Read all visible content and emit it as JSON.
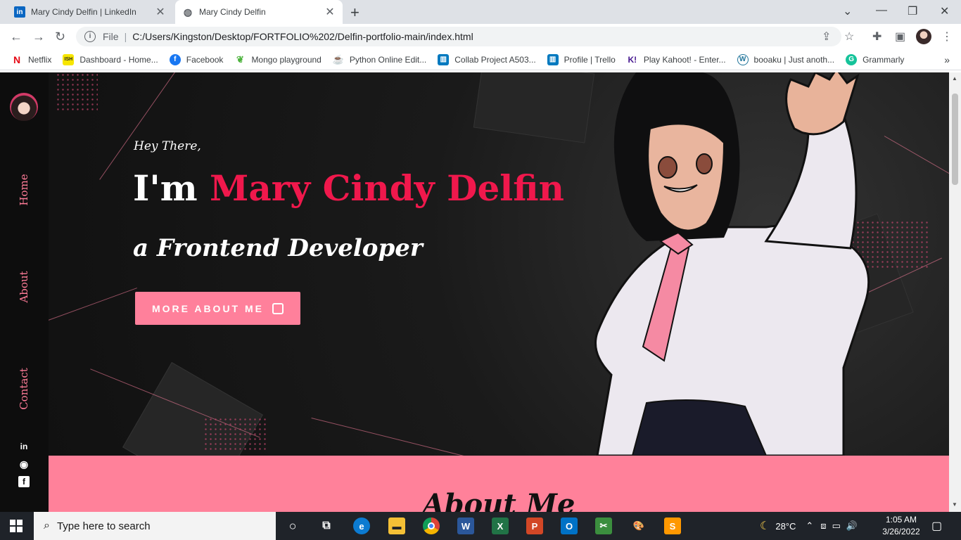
{
  "browser": {
    "tabs": [
      {
        "title": "Mary Cindy Delfin | LinkedIn",
        "icon": "linkedin-icon"
      },
      {
        "title": "Mary Cindy Delfin",
        "icon": "globe-icon"
      }
    ],
    "address": {
      "scheme_label": "File",
      "url": "C:/Users/Kingston/Desktop/FORTFOLIO%202/Delfin-portfolio-main/index.html"
    },
    "bookmarks": [
      {
        "label": "Netflix",
        "icon": "netflix-icon",
        "color": "#e50914"
      },
      {
        "label": "Dashboard - Home...",
        "icon": "dashboard-icon",
        "color": "#f7e600"
      },
      {
        "label": "Facebook",
        "icon": "facebook-icon",
        "color": "#1877f2"
      },
      {
        "label": "Mongo playground",
        "icon": "mongo-icon",
        "color": "#4db33d"
      },
      {
        "label": "Python Online Edit...",
        "icon": "python-icon",
        "color": "#333333"
      },
      {
        "label": "Collab Project A503...",
        "icon": "trello-icon",
        "color": "#0079bf"
      },
      {
        "label": "Profile | Trello",
        "icon": "trello-icon",
        "color": "#0079bf"
      },
      {
        "label": "Play Kahoot! - Enter...",
        "icon": "kahoot-icon",
        "color": "#46178f"
      },
      {
        "label": "booaku | Just anoth...",
        "icon": "wordpress-icon",
        "color": "#21759b"
      },
      {
        "label": "Grammarly",
        "icon": "grammarly-icon",
        "color": "#15c39a"
      }
    ]
  },
  "page": {
    "nav": {
      "home": "Home",
      "about": "About",
      "contact": "Contact"
    },
    "hero": {
      "greeting": "Hey There,",
      "intro": "I'm ",
      "name": "Mary Cindy Delfin",
      "role": "a Frontend Developer",
      "cta": "MORE ABOUT ME"
    },
    "about_title": "About Me",
    "accent": "#f0184c",
    "pink": "#ff809b"
  },
  "taskbar": {
    "search_placeholder": "Type here to search",
    "weather": "28°C",
    "time": "1:05 AM",
    "date": "3/26/2022"
  }
}
